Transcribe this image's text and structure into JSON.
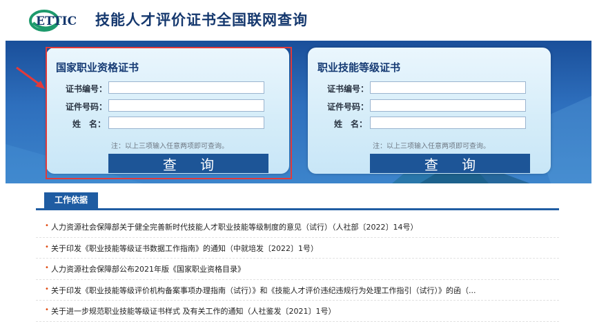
{
  "header": {
    "logo_text": "ETTIC",
    "title": "技能人才评价证书全国联网查询"
  },
  "panels": [
    {
      "title": "国家职业资格证书",
      "labels": [
        "证书编号：",
        "证件号码：",
        "姓　名："
      ],
      "values": [
        "",
        "",
        ""
      ],
      "note": "注：以上三项输入任意两项即可查询。",
      "button": "查 询"
    },
    {
      "title": "职业技能等级证书",
      "labels": [
        "证书编号：",
        "证件号码：",
        "姓　名："
      ],
      "values": [
        "",
        "",
        ""
      ],
      "note": "注：以上三项输入任意两项即可查询。",
      "button": "查 询"
    }
  ],
  "section": {
    "tab": "工作依据"
  },
  "items": [
    "人力资源社会保障部关于健全完善新时代技能人才职业技能等级制度的意见（试行）（人社部〔2022〕14号）",
    "关于印发《职业技能等级证书数据工作指南》的通知（中就培发〔2022〕1号）",
    "人力资源社会保障部公布2021年版《国家职业资格目录》",
    "关于印发《职业技能等级评价机构备案事项办理指南（试行）》和《技能人才评价违纪违规行为处理工作指引（试行）》的函（...",
    "关于进一步规范职业技能等级证书样式 及有关工作的通知（人社鉴发〔2021〕1号）"
  ],
  "colors": {
    "brand": "#15386e",
    "banner": "#2e6fbd",
    "button": "#1d5597",
    "highlight": "#e23a3a",
    "bullet": "#e04a10"
  },
  "icons": {
    "logo": "ettic-logo",
    "arrow": "pointer-arrow-icon"
  }
}
